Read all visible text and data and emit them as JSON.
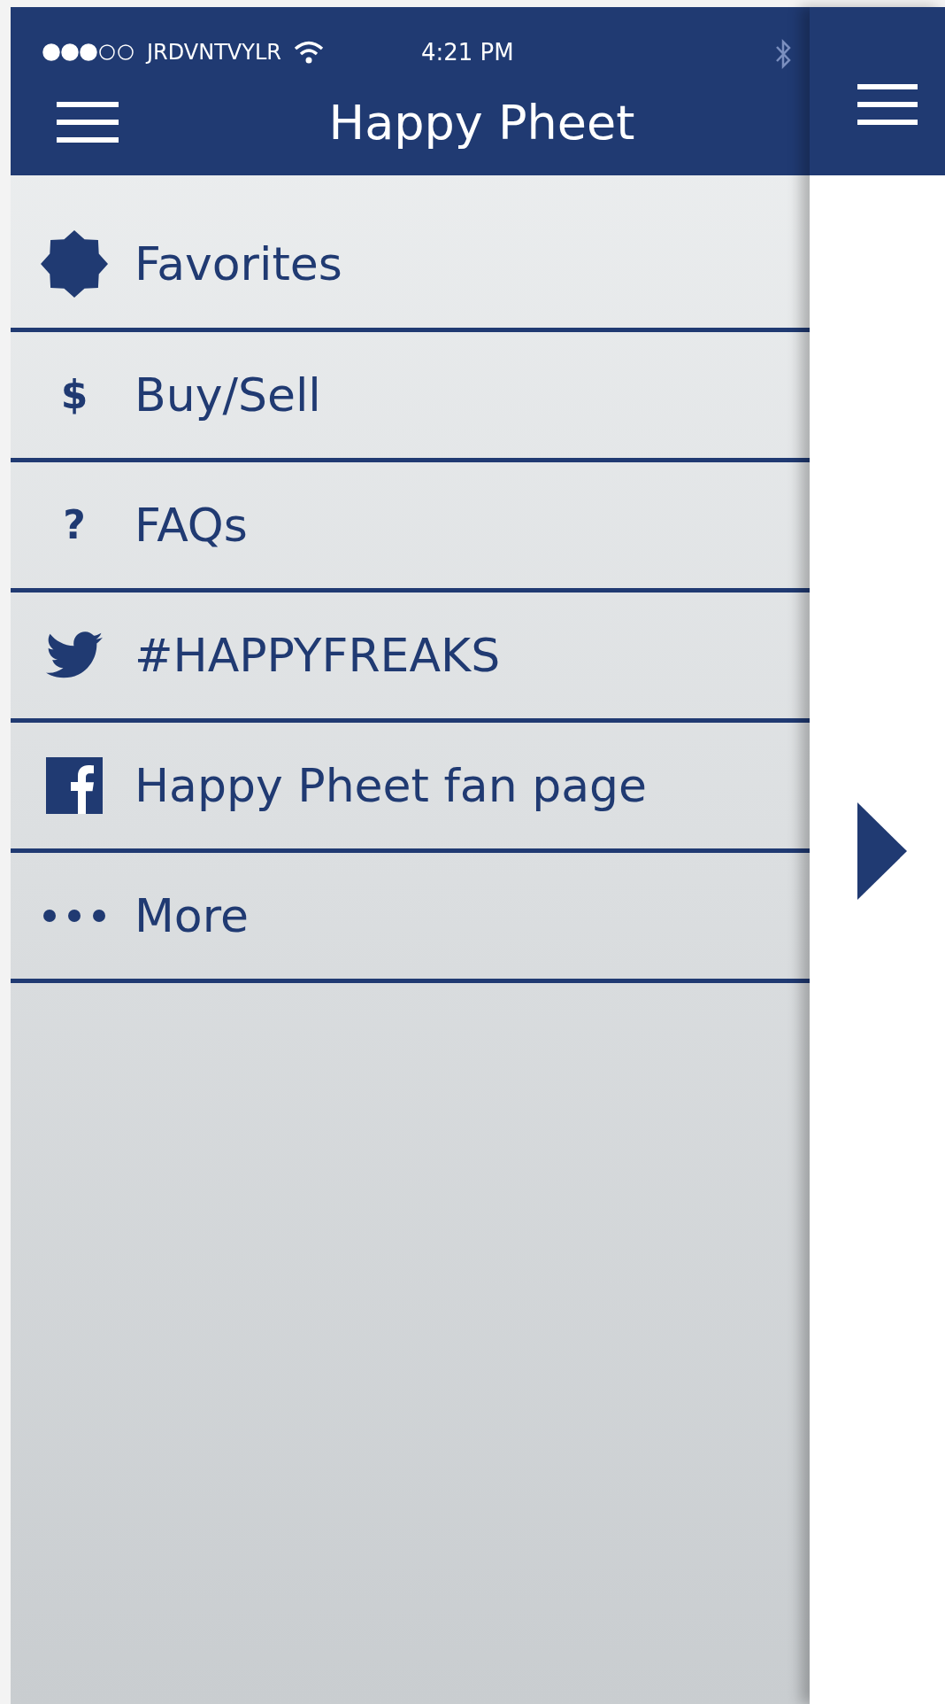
{
  "status_bar": {
    "signal_dots": [
      {
        "filled": true
      },
      {
        "filled": true
      },
      {
        "filled": true
      },
      {
        "filled": false
      },
      {
        "filled": false
      }
    ],
    "carrier": "JRDVNTVYLR",
    "time": "4:21 PM"
  },
  "header": {
    "title": "Happy Pheet"
  },
  "menu": [
    {
      "kind": "badge",
      "label": "Favorites"
    },
    {
      "kind": "glyph",
      "glyph": "$",
      "label": "Buy/Sell"
    },
    {
      "kind": "glyph",
      "glyph": "?",
      "label": "FAQs"
    },
    {
      "kind": "bird",
      "label": "#HAPPYFREAKS"
    },
    {
      "kind": "facebook",
      "label": "Happy Pheet fan page"
    },
    {
      "kind": "dots",
      "label": "More"
    }
  ]
}
